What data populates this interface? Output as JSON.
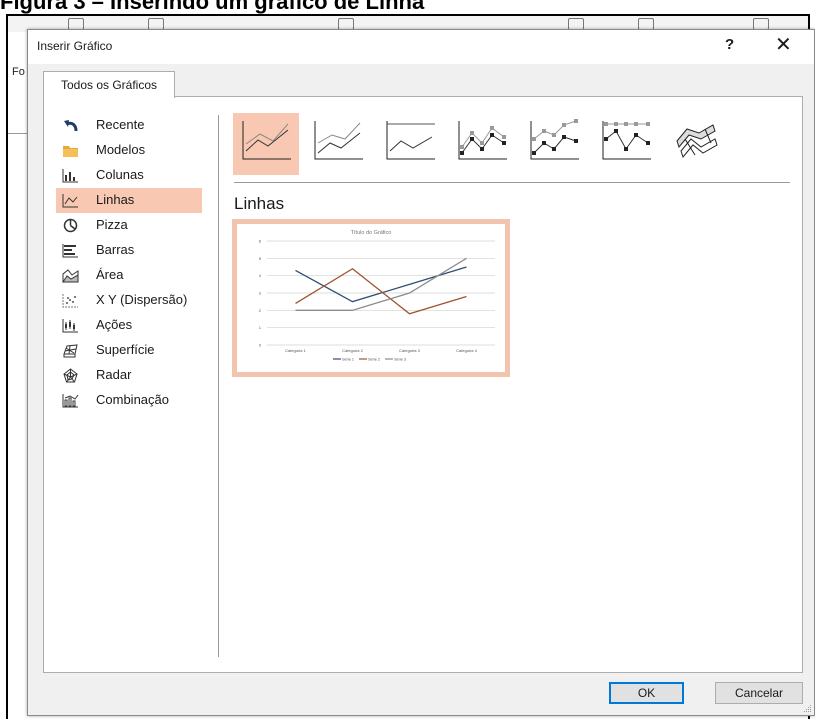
{
  "caption": "Figura 3 – Inserindo um gráfico de Linha",
  "background": {
    "fo_text": "Fo"
  },
  "dialog": {
    "title": "Inserir Gráfico",
    "help_label": "?",
    "close_label": "✕",
    "tab_label": "Todos os Gráficos",
    "categories": [
      {
        "label": "Recente",
        "icon": "undo-arrow-icon"
      },
      {
        "label": "Modelos",
        "icon": "folder-icon"
      },
      {
        "label": "Colunas",
        "icon": "column-chart-icon"
      },
      {
        "label": "Linhas",
        "icon": "line-chart-icon",
        "selected": true
      },
      {
        "label": "Pizza",
        "icon": "pie-chart-icon"
      },
      {
        "label": "Barras",
        "icon": "bar-chart-icon"
      },
      {
        "label": "Área",
        "icon": "area-chart-icon"
      },
      {
        "label": "X Y (Dispersão)",
        "icon": "scatter-chart-icon"
      },
      {
        "label": "Ações",
        "icon": "stock-chart-icon"
      },
      {
        "label": "Superfície",
        "icon": "surface-chart-icon"
      },
      {
        "label": "Radar",
        "icon": "radar-chart-icon"
      },
      {
        "label": "Combinação",
        "icon": "combo-chart-icon"
      }
    ],
    "selected_category_title": "Linhas",
    "ok_label": "OK",
    "cancel_label": "Cancelar",
    "accent_color": "#f8c8b2",
    "preview": {
      "title": "Título do Gráfico",
      "categories": [
        "Categoria 1",
        "Categoria 2",
        "Categoria 3",
        "Categoria 4"
      ],
      "y_ticks": [
        "0",
        "1",
        "2",
        "3",
        "4",
        "5",
        "6"
      ],
      "ylim": [
        0,
        6
      ],
      "series": [
        {
          "name": "Série 1",
          "values": [
            4.3,
            2.5,
            3.5,
            4.5
          ],
          "color": "#2f4e74"
        },
        {
          "name": "Série 2",
          "values": [
            2.4,
            4.4,
            1.8,
            2.8
          ],
          "color": "#a0522d"
        },
        {
          "name": "Série 3",
          "values": [
            2.0,
            2.0,
            3.0,
            5.0
          ],
          "color": "#8c8c8c"
        }
      ]
    }
  }
}
